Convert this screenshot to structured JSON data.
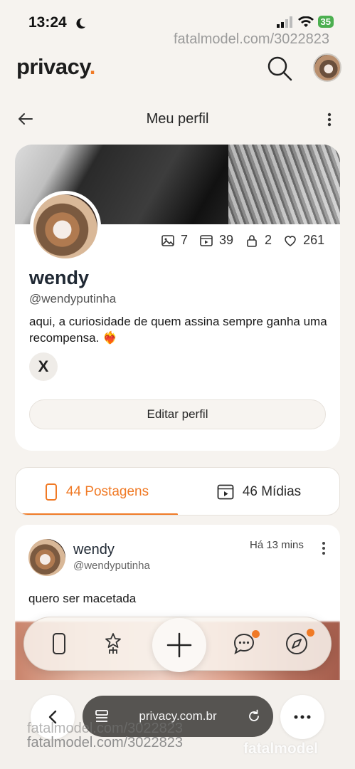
{
  "status_bar": {
    "time": "13:24",
    "battery": "35"
  },
  "watermark": {
    "top": "fatalmodel.com/3022823",
    "bottom_line1": "fatalmodel.com/3022823",
    "bottom_line2": "fatalmodel.com/3022823",
    "brand": "fatalmodel"
  },
  "header": {
    "logo_text": "privacy",
    "logo_dot": ".",
    "accent_color": "#f07a26"
  },
  "nav": {
    "title": "Meu perfil"
  },
  "profile": {
    "stats": {
      "photos": "7",
      "videos": "39",
      "locked": "2",
      "likes": "261"
    },
    "display_name": "wendy",
    "username": "@wendyputinha",
    "bio": "aqui, a curiosidade de quem assina sempre ganha uma recompensa.",
    "bio_emoji": "❤️‍🔥",
    "social_icon": "X",
    "edit_button": "Editar perfil"
  },
  "tabs": {
    "posts_label": "44 Postagens",
    "media_label": "46 Mídias",
    "active": "posts"
  },
  "post": {
    "name": "wendy",
    "username": "@wendyputinha",
    "time": "Há 13 mins",
    "text": "quero ser macetada"
  },
  "bottom_nav": {
    "items": [
      "feed-icon",
      "star-person-icon",
      "plus-icon",
      "chat-icon",
      "compass-icon"
    ]
  },
  "browser": {
    "url": "privacy.com.br"
  }
}
